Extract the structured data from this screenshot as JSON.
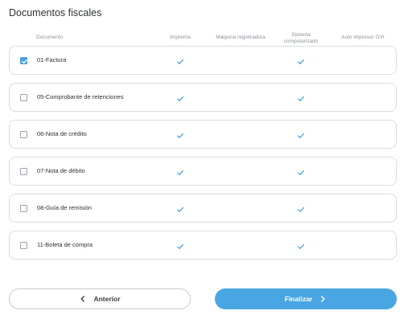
{
  "page": {
    "title": "Documentos fiscales"
  },
  "columns": {
    "documento": "Documento",
    "imprenta": "Imprenta",
    "maquina": "Máquina registradora",
    "sistema_line1": "Sistema",
    "sistema_line2": "computarizado",
    "auto": "Auto impresor OVI"
  },
  "rows": [
    {
      "label": "01-Factura",
      "checked": true,
      "imprenta": true,
      "maquina": false,
      "sistema": true,
      "auto": false
    },
    {
      "label": "05-Comprobante de retenciones",
      "checked": false,
      "imprenta": true,
      "maquina": false,
      "sistema": true,
      "auto": false
    },
    {
      "label": "06-Nota de crédito",
      "checked": false,
      "imprenta": true,
      "maquina": false,
      "sistema": true,
      "auto": false
    },
    {
      "label": "07-Nota de débito",
      "checked": false,
      "imprenta": true,
      "maquina": false,
      "sistema": true,
      "auto": false
    },
    {
      "label": "08-Guía de remisión",
      "checked": false,
      "imprenta": true,
      "maquina": false,
      "sistema": true,
      "auto": false
    },
    {
      "label": "11-Boleta de compra",
      "checked": false,
      "imprenta": true,
      "maquina": false,
      "sistema": true,
      "auto": false
    }
  ],
  "footer": {
    "prev_label": "Anterior",
    "next_label": "Finalizar"
  },
  "colors": {
    "accent": "#4aa6e3",
    "tick": "#4a9fde",
    "border": "#d9dde1"
  },
  "icons": {
    "check": "check-icon",
    "prev": "chevron-left-icon",
    "next": "chevron-right-icon"
  }
}
